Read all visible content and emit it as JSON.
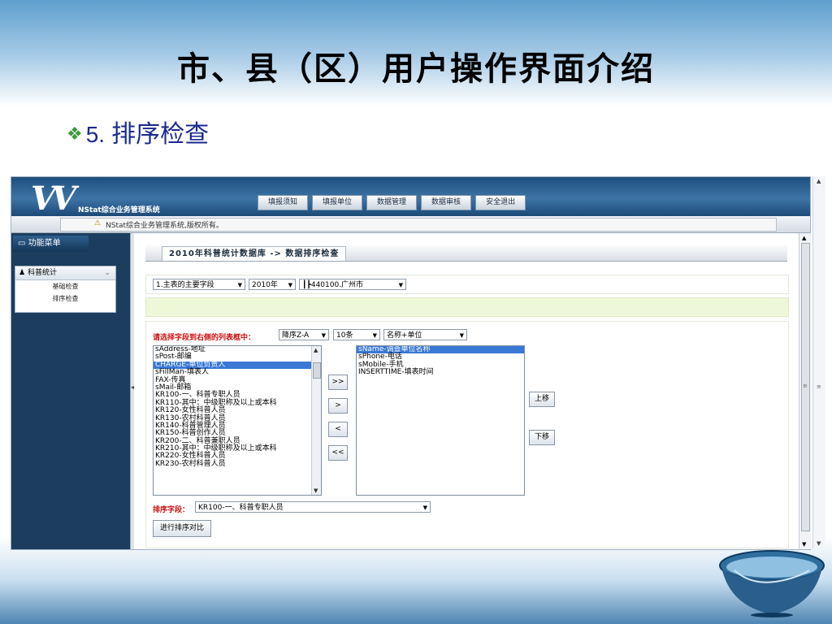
{
  "slide": {
    "title": "市、县（区）用户操作界面介绍",
    "bullet_number": "5.",
    "bullet_text": "排序检查"
  },
  "app": {
    "name": "NStat综合业务管理系统",
    "nav": [
      "填报须知",
      "填报单位",
      "数据管理",
      "数据审核",
      "安全退出"
    ],
    "status_text": "NStat综合业务管理系统,版权所有。"
  },
  "sidebar": {
    "header": "功能菜单",
    "group": "科普统计",
    "items": [
      "基础检查",
      "排序检查"
    ]
  },
  "main": {
    "breadcrumb": "2010年科普统计数据库 -> 数据排序检查",
    "filters": {
      "field": "1.主表的主要字段",
      "year": "2010年",
      "region": "┃┣440100.广州市"
    },
    "prompt": "请选择字段到右侧的列表框中：",
    "order": "降序Z-A",
    "count": "10条",
    "display": "名称+单位",
    "left_list": [
      "sAddress-地址",
      "sPost-邮编",
      "CHARGE-单位负责人",
      "sFillMan-填表人",
      "FAX-传真",
      "sMail-邮箱",
      "KR100-一、科普专职人员",
      "KR110-其中：中级职称及以上或本科",
      "KR120-女性科普人员",
      "KR130-农村科普人员",
      "KR140-科普管理人员",
      "KR150-科普创作人员",
      "KR200-二、科普兼职人员",
      "KR210-其中：中级职称及以上或本科",
      "KR220-女性科普人员",
      "KR230-农村科普人员"
    ],
    "left_selected": "CHARGE-单位负责人",
    "right_list": [
      "sName-调查单位名称",
      "sPhone-电话",
      "sMobile-手机",
      "INSERTTIME-填表时间"
    ],
    "right_selected": "sName-调查单位名称",
    "move_buttons": [
      ">>",
      ">",
      "<",
      "<<"
    ],
    "up_button": "上移",
    "down_button": "下移",
    "sort_label": "排序字段：",
    "sort_value": "KR100-一、科普专职人员",
    "run_button": "进行排序对比"
  }
}
